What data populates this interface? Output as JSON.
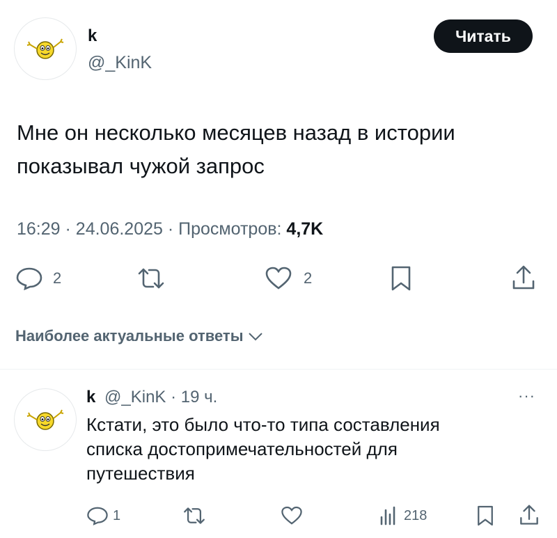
{
  "tweet": {
    "author_name": "k",
    "author_handle": "@_KinK",
    "follow_label": "Читать",
    "text_line1": "Мне он несколько месяцев назад в истории",
    "text_line2": "показывал чужой запрос",
    "time": "16:29",
    "sep1": "·",
    "date": "24.06.2025",
    "sep2": "·",
    "views_label": "Просмотров:",
    "views_count": "4,7K",
    "actions": {
      "reply_count": "2",
      "like_count": "2"
    }
  },
  "sort_label": "Наиболее актуальные ответы",
  "reply": {
    "author_name": "k",
    "author_handle": "@_KinK",
    "sep": "·",
    "age": "19 ч.",
    "more": "···",
    "text_line1": "Кстати, это было что-то типа составления",
    "text_line2": "списка достопримечательностей для",
    "text_line3": "путешествия",
    "actions": {
      "reply_count": "1",
      "views_count": "218"
    }
  },
  "icons": {
    "avatar": "smiley-emoticon-icon",
    "reply": "speech-bubble-icon",
    "repost": "repost-arrows-icon",
    "like": "heart-icon",
    "bookmark": "bookmark-icon",
    "share": "share-upload-icon",
    "views": "bar-chart-icon",
    "chevron": "chevron-down-icon",
    "more": "more-dots-icon"
  },
  "colors": {
    "text": "#0f1419",
    "secondary": "#536471",
    "button_bg": "#0f1419",
    "divider": "#eff3f4"
  }
}
